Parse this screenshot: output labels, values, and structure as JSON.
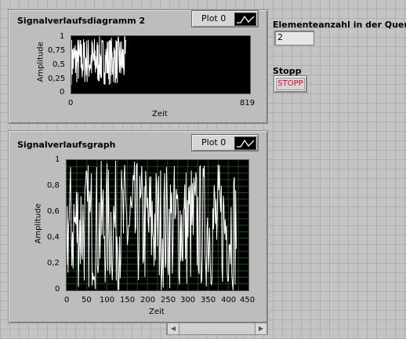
{
  "chart1": {
    "title": "Signalverlaufsdiagramm 2",
    "legend_label": "Plot 0",
    "ylabel": "Amplitude",
    "xlabel": "Zeit",
    "y_ticks": [
      "1",
      "0,75",
      "0,5",
      "0,25",
      "0"
    ],
    "x_ticks": [
      "0",
      "819"
    ]
  },
  "chart2": {
    "title": "Signalverlaufsgraph",
    "legend_label": "Plot 0",
    "ylabel": "Amplitude",
    "xlabel": "Zeit",
    "y_ticks": [
      "1",
      "0,8",
      "0,6",
      "0,4",
      "0,2",
      "0"
    ],
    "x_ticks": [
      "0",
      "50",
      "100",
      "150",
      "200",
      "250",
      "300",
      "350",
      "400",
      "450"
    ]
  },
  "queue": {
    "label": "Elementeanzahl in der Queue",
    "value": "2"
  },
  "stop": {
    "label": "Stopp",
    "button_label": "STOPP"
  },
  "colors": {
    "plot_bg": "#000000",
    "trace": "#ffffff",
    "grid": "#1f4a1f",
    "stop_text": "#e0002a"
  },
  "chart_data": [
    {
      "type": "line",
      "title": "Signalverlaufsdiagramm 2",
      "xlabel": "Zeit",
      "ylabel": "Amplitude",
      "xlim": [
        0,
        819
      ],
      "ylim": [
        0,
        1
      ],
      "grid": false,
      "series": [
        {
          "name": "Plot 0",
          "x_range": [
            0,
            250
          ],
          "y_range": [
            0.15,
            1.0
          ],
          "pattern": "random noise"
        }
      ]
    },
    {
      "type": "line",
      "title": "Signalverlaufsgraph",
      "xlabel": "Zeit",
      "ylabel": "Amplitude",
      "xlim": [
        0,
        450
      ],
      "ylim": [
        0,
        1
      ],
      "grid": true,
      "series": [
        {
          "name": "Plot 0",
          "x_range": [
            0,
            420
          ],
          "y_range": [
            0,
            1.0
          ],
          "pattern": "random noise"
        }
      ]
    }
  ]
}
